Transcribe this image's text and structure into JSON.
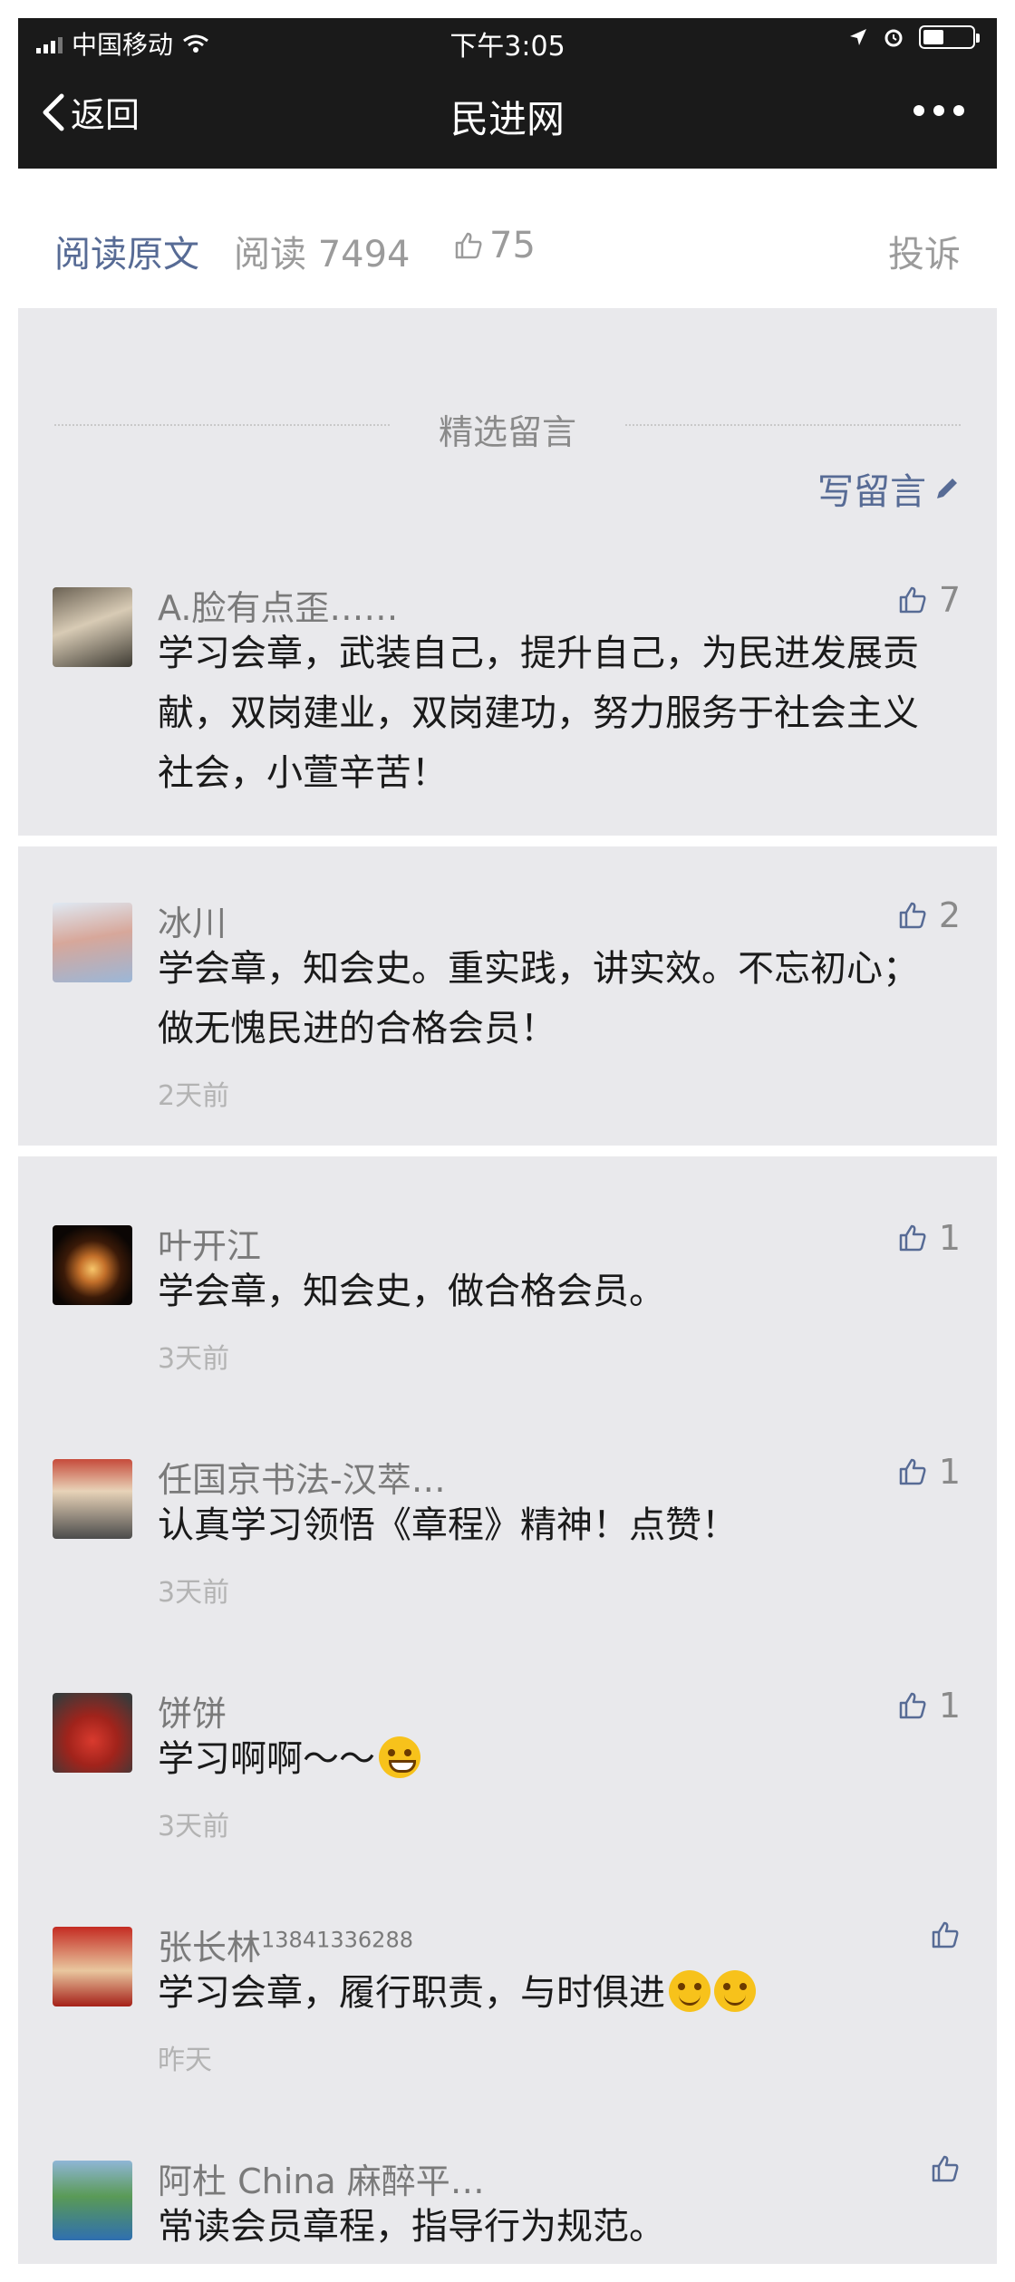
{
  "status_bar": {
    "carrier": "中国移动",
    "time": "下午3:05"
  },
  "nav": {
    "back_label": "返回",
    "title": "民进网"
  },
  "article_bar": {
    "read_original": "阅读原文",
    "read_count": "阅读 7494",
    "like_count": "75",
    "complain": "投诉"
  },
  "comments_section": {
    "title": "精选留言",
    "write_label": "写留言",
    "items": [
      {
        "nickname": "A.脸有点歪……",
        "text": "学习会章，武装自己，提升自己，为民进发展贡献，双岗建业，双岗建功，努力服务于社会主义社会，小萱辛苦！",
        "time": "",
        "likes": "7"
      },
      {
        "nickname": "冰川",
        "text": "学会章，知会史。重实践，讲实效。不忘初心；做无愧民进的合格会员！",
        "time": "2天前",
        "likes": "2"
      },
      {
        "nickname": "叶开江",
        "text": "学会章，知会史，做合格会员。",
        "time": "3天前",
        "likes": "1"
      },
      {
        "nickname": "任国京书法-汉萃…",
        "text": "认真学习领悟《章程》精神！点赞！",
        "time": "3天前",
        "likes": "1"
      },
      {
        "nickname": "饼饼",
        "text": "学习啊啊～～",
        "time": "3天前",
        "likes": "1"
      },
      {
        "nickname": "张长林",
        "nickname_sup": "13841336288",
        "text": "学习会章，履行职责，与时俱进",
        "time": "昨天",
        "likes": ""
      },
      {
        "nickname": "阿杜 China 麻醉平…",
        "text": "常读会员章程，指导行为规范。",
        "time": "",
        "likes": ""
      }
    ]
  },
  "colors": {
    "link": "#576b95",
    "nav_bg": "#1a1a1a",
    "comment_bg": "#e9e9ec"
  }
}
